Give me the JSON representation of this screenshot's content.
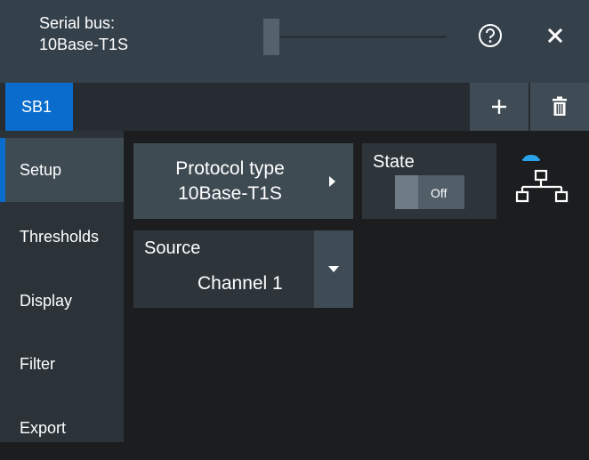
{
  "header": {
    "title_line1": "Serial bus:",
    "title_line2": "10Base-T1S",
    "help_icon": "help-circle-icon",
    "close_icon": "close-icon"
  },
  "tabs": {
    "active_label": "SB1",
    "add_icon": "plus-icon",
    "delete_icon": "trash-icon"
  },
  "sidebar": {
    "items": [
      {
        "label": "Setup",
        "active": true
      },
      {
        "label": "Thresholds",
        "active": false
      },
      {
        "label": "Display",
        "active": false
      },
      {
        "label": "Filter",
        "active": false
      },
      {
        "label": "Export",
        "active": false
      }
    ]
  },
  "protocol": {
    "label": "Protocol type",
    "value": "10Base-T1S",
    "arrow_icon": "chevron-right-icon"
  },
  "state": {
    "label": "State",
    "toggle_text": "Off"
  },
  "network_icon": {
    "name": "network-topology-icon",
    "indicator_color": "#2aa3e8"
  },
  "source": {
    "label": "Source",
    "value": "Channel 1",
    "dropdown_icon": "chevron-down-icon"
  },
  "colors": {
    "accent": "#0a6ccd",
    "header_bg": "#35414a",
    "panel_bg": "#2d353b"
  }
}
